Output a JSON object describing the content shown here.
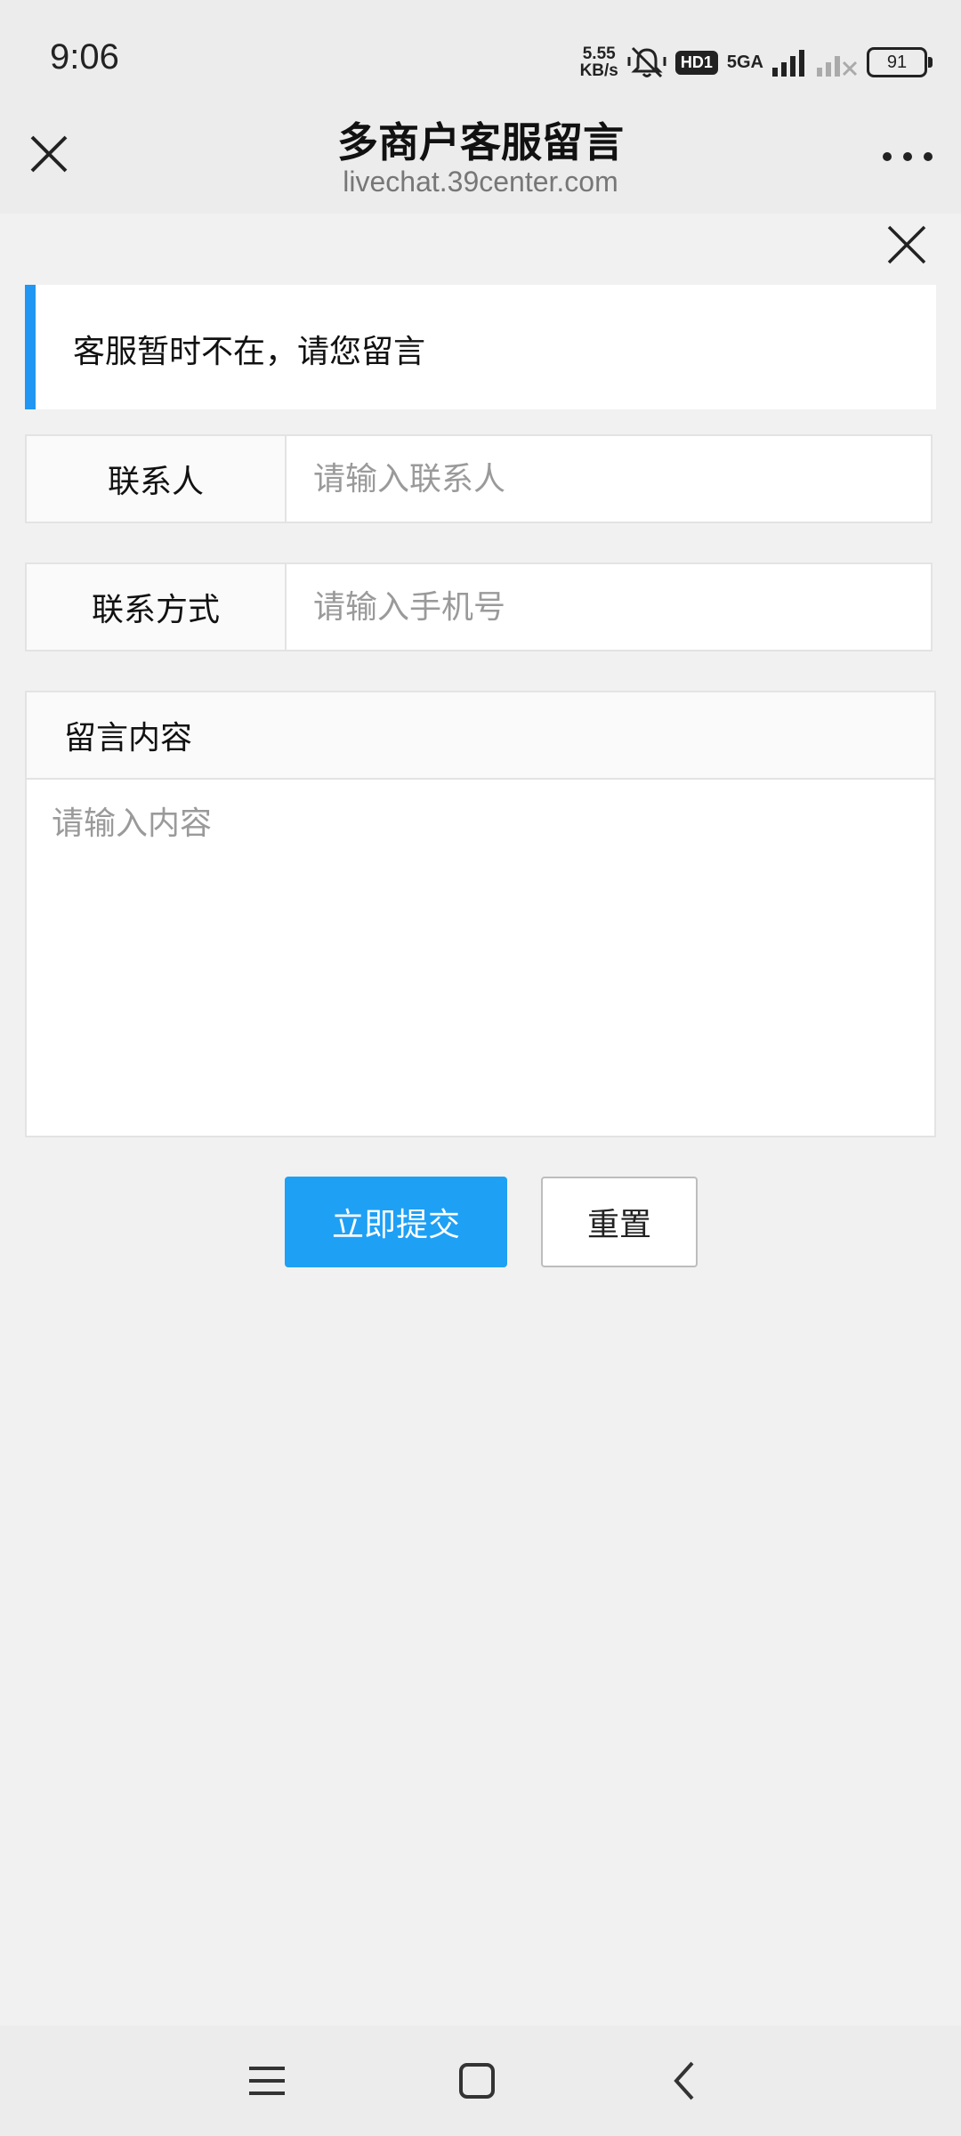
{
  "status_bar": {
    "time": "9:06",
    "net_speed_value": "5.55",
    "net_speed_unit": "KB/s",
    "hd_label": "HD1",
    "network_label": "5GA",
    "battery": "91"
  },
  "nav": {
    "title": "多商户客服留言",
    "subtitle": "livechat.39center.com"
  },
  "notice": {
    "text": "客服暂时不在，请您留言"
  },
  "form": {
    "contact_label": "联系人",
    "contact_placeholder": "请输入联系人",
    "phone_label": "联系方式",
    "phone_placeholder": "请输入手机号",
    "message_label": "留言内容",
    "message_placeholder": "请输入内容"
  },
  "buttons": {
    "submit_label": "立即提交",
    "reset_label": "重置"
  },
  "colors": {
    "accent": "#1ea0f5",
    "notice_bar": "#2196f3",
    "background": "#f1f1f1"
  }
}
